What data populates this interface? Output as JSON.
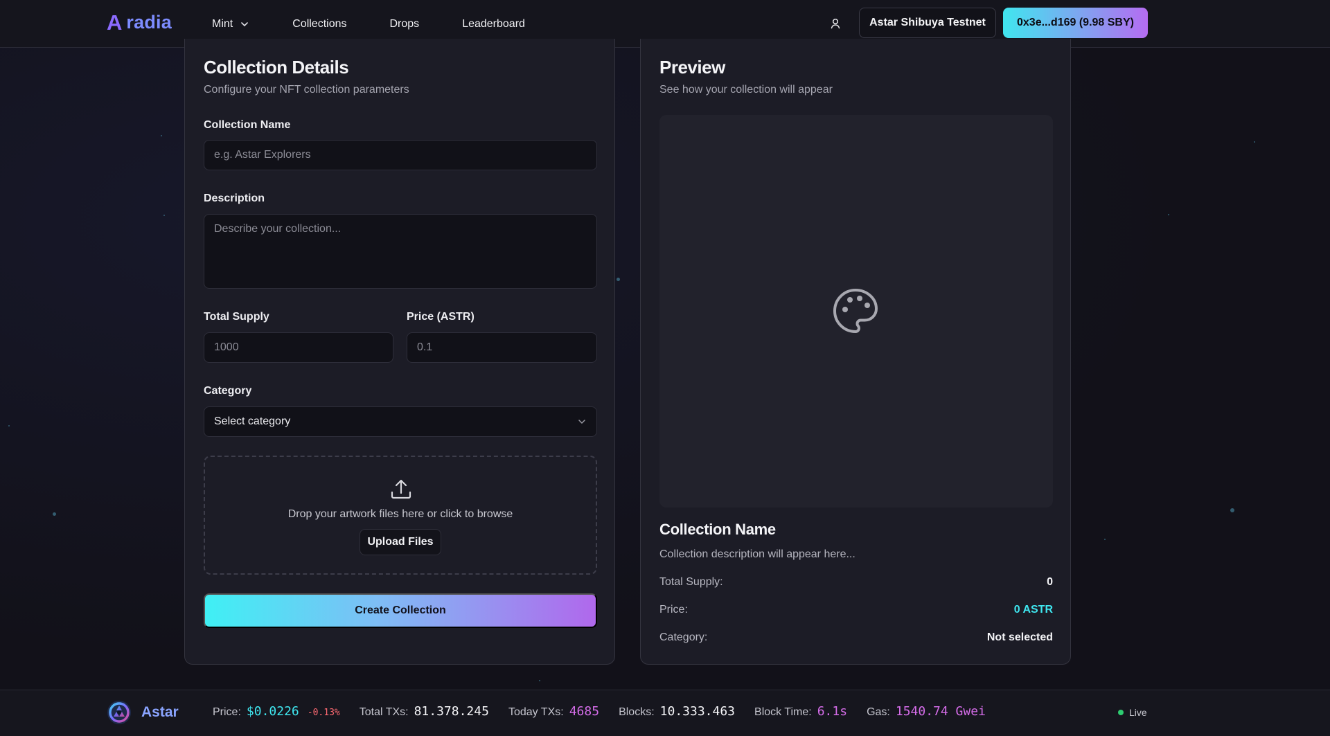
{
  "navbar": {
    "logo_mark": "A",
    "logo_text": "radia",
    "links": [
      {
        "label": "Mint",
        "has_dropdown": true
      },
      {
        "label": "Collections"
      },
      {
        "label": "Drops"
      },
      {
        "label": "Leaderboard"
      }
    ],
    "network_label": "Astar Shibuya Testnet",
    "wallet_label": "0x3e...d169 (9.98 SBY)"
  },
  "form": {
    "title": "Collection Details",
    "subtitle": "Configure your NFT collection parameters",
    "name_label": "Collection Name",
    "name_placeholder": "e.g. Astar Explorers",
    "description_label": "Description",
    "description_placeholder": "Describe your collection...",
    "supply_label": "Total Supply",
    "supply_placeholder": "1000",
    "price_label": "Price (ASTR)",
    "price_placeholder": "0.1",
    "category_label": "Category",
    "category_value": "Select category",
    "drop_text": "Drop your artwork files here or click to browse",
    "upload_label": "Upload Files",
    "create_label": "Create Collection"
  },
  "preview": {
    "title": "Preview",
    "subtitle": "See how your collection will appear",
    "name": "Collection Name",
    "description": "Collection description will appear here...",
    "stats": [
      {
        "label": "Total Supply:",
        "value": "0"
      },
      {
        "label": "Price:",
        "value": "0 ASTR"
      },
      {
        "label": "Category:",
        "value": "Not selected"
      }
    ]
  },
  "footer": {
    "chain_name": "Astar",
    "price_label": "Price:",
    "price_value": "$0.0226",
    "price_change": "-0.13%",
    "total_tx_label": "Total TXs:",
    "total_tx_value": "81.378.245",
    "today_tx_label": "Today TXs:",
    "today_tx_value": "4685",
    "blocks_label": "Blocks:",
    "blocks_value": "10.333.463",
    "block_time_label": "Block Time:",
    "block_time_value": "6.1s",
    "gas_label": "Gas:",
    "gas_value": "1540.74 Gwei",
    "live_label": "Live"
  },
  "colors": {
    "accent_cyan": "#3fe6ef",
    "accent_purple": "#b56cf1",
    "magenta": "#d46ce8",
    "background": "#13121d"
  },
  "icons": [
    "chevron-down-icon",
    "user-icon",
    "upload-icon",
    "palette-icon",
    "astar-logo-icon"
  ]
}
